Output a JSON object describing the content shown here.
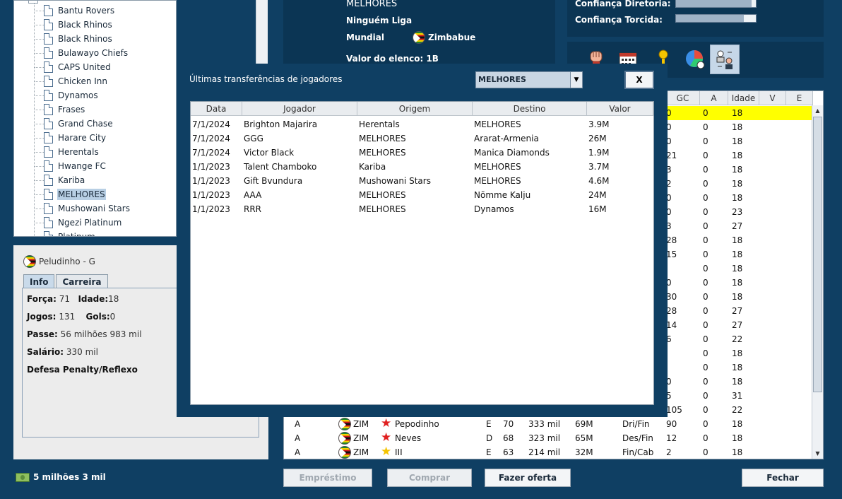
{
  "tree": {
    "items": [
      "Bantu Rovers",
      "Black Rhinos",
      "Black Rhinos",
      "Bulawayo Chiefs",
      "CAPS United",
      "Chicken Inn",
      "Dynamos",
      "Frases",
      "Grand Chase",
      "Harare City",
      "Herentals",
      "Hwange FC",
      "Kariba",
      "MELHORES",
      "Mushowani Stars",
      "Ngezi Platinum",
      "Platinum"
    ],
    "selected_index": 13
  },
  "player_card": {
    "name": "Peludinho - G",
    "tabs": [
      "Info",
      "Carreira"
    ],
    "active_tab": "Info",
    "forca_label": "Força:",
    "forca": "71",
    "idade_label": "Idade:",
    "idade": "18",
    "jogos_label": "Jogos:",
    "jogos": "131",
    "gols_label": "Gols:",
    "gols": "0",
    "passe_label": "Passe:",
    "passe": "56 milhões 983 mil",
    "salario_label": "Salário:",
    "salario": "330 mil",
    "skill": "Defesa Penalty/Reflexo"
  },
  "money": "5 milhões 3 mil",
  "club": {
    "name": "MELHORES",
    "league": "Ninguém Liga",
    "mundial_label": "Mundial",
    "country": "Zimbabue",
    "valor": "Valor do elenco: 1B"
  },
  "confidence": {
    "diretoria_label": "Confiança Diretoria:",
    "diretoria": 0.95,
    "torcida_label": "Confiança Torcida:",
    "torcida": 0.85
  },
  "toolbar_icons": [
    "fist-icon",
    "calendar-icon",
    "trophy-icon",
    "stats-pie-icon",
    "transfers-icon"
  ],
  "table": {
    "headers": [
      "GC",
      "A",
      "Idade",
      "V",
      "E"
    ],
    "partial_gc": [
      "0",
      "0",
      "0",
      "21",
      "3",
      "2",
      "0",
      "0",
      "3",
      "28",
      "15",
      "",
      "0",
      "30",
      "28",
      "14",
      "6",
      "",
      "",
      "0",
      "5",
      "105"
    ],
    "a_col": [
      "0",
      "0",
      "0",
      "0",
      "0",
      "0",
      "0",
      "0",
      "0",
      "0",
      "0",
      "0",
      "0",
      "0",
      "0",
      "0",
      "0",
      "0",
      "0",
      "0",
      "0",
      "0"
    ],
    "idade_col": [
      "18",
      "18",
      "18",
      "18",
      "18",
      "18",
      "18",
      "23",
      "27",
      "18",
      "18",
      "18",
      "18",
      "18",
      "27",
      "27",
      "22",
      "18",
      "18",
      "18",
      "31",
      "22"
    ],
    "bottom_rows": [
      {
        "pos": "A",
        "nat": "ZIM",
        "star": "red",
        "name": "Pepodinho",
        "lado": "E",
        "f": "70",
        "sal": "333 mil",
        "val": "69M",
        "car": "Dri/Fin",
        "gc": "90",
        "a": "0",
        "idade": "18"
      },
      {
        "pos": "A",
        "nat": "ZIM",
        "star": "red",
        "name": "Neves",
        "lado": "D",
        "f": "68",
        "sal": "323 mil",
        "val": "65M",
        "car": "Des/Fin",
        "gc": "12",
        "a": "0",
        "idade": "18"
      },
      {
        "pos": "A",
        "nat": "ZIM",
        "star": "gold",
        "name": "III",
        "lado": "E",
        "f": "63",
        "sal": "214 mil",
        "val": "32M",
        "car": "Fin/Cab",
        "gc": "2",
        "a": "0",
        "idade": "18"
      }
    ]
  },
  "buttons": {
    "emprestimo": "Empréstimo",
    "comprar": "Comprar",
    "fazer_oferta": "Fazer oferta",
    "fechar": "Fechar"
  },
  "dialog": {
    "title": "Últimas transferências de jogadores",
    "filter": "MELHORES",
    "close": "X",
    "headers": [
      "Data",
      "Jogador",
      "Origem",
      "Destino",
      "Valor"
    ],
    "rows": [
      [
        "7/1/2024",
        "Brighton Majarira",
        "Herentals",
        "MELHORES",
        "3.9M"
      ],
      [
        "7/1/2024",
        "GGG",
        "MELHORES",
        "Ararat-Armenia",
        "26M"
      ],
      [
        "7/1/2024",
        "Victor Black",
        "MELHORES",
        "Manica Diamonds",
        "1.9M"
      ],
      [
        "1/1/2023",
        "Talent Chamboko",
        "Kariba",
        "MELHORES",
        "3.7M"
      ],
      [
        "1/1/2023",
        "Gift Bvundura",
        "Mushowani Stars",
        "MELHORES",
        "4.6M"
      ],
      [
        "1/1/2023",
        "AAA",
        "MELHORES",
        "Nõmme Kalju",
        "24M"
      ],
      [
        "1/1/2023",
        "RRR",
        "MELHORES",
        "Dynamos",
        "16M"
      ]
    ]
  }
}
